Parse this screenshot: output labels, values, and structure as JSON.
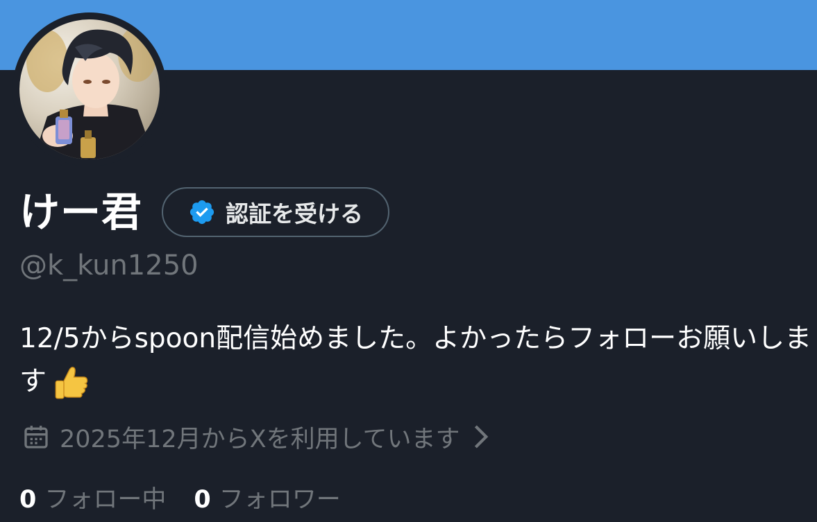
{
  "profile": {
    "display_name": "けー君",
    "handle": "@k_kun1250",
    "bio_text": "12/5からspoon配信始めました。よかったらフォローお願いします",
    "bio_emoji": "thumbs-up",
    "joined": "2025年12月からXを利用しています",
    "verify_button_label": "認証を受ける"
  },
  "stats": {
    "following_count": "0",
    "following_label": "フォロー中",
    "followers_count": "0",
    "followers_label": "フォロワー"
  },
  "colors": {
    "banner": "#4a95e0",
    "background": "#1b202a",
    "verified_badge": "#1d9bf0",
    "secondary_text": "#71767b"
  },
  "icons": {
    "verified": "verified-badge-icon",
    "calendar": "calendar-icon",
    "chevron": "chevron-right-icon"
  }
}
